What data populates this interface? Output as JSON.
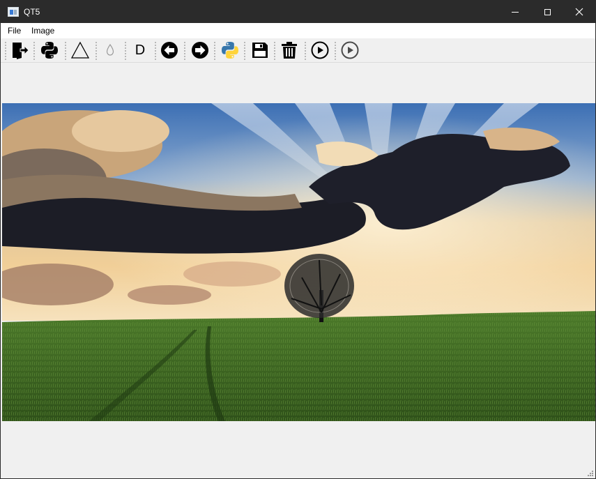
{
  "window": {
    "title": "QT5"
  },
  "menu": {
    "file": "File",
    "image": "Image"
  },
  "toolbar": {
    "d_label": "D"
  },
  "colors": {
    "titlebar": "#2b2b2b",
    "canvas": "#f0f0f0",
    "sky_top": "#3c6fb4",
    "grass": "#3f6b25"
  }
}
